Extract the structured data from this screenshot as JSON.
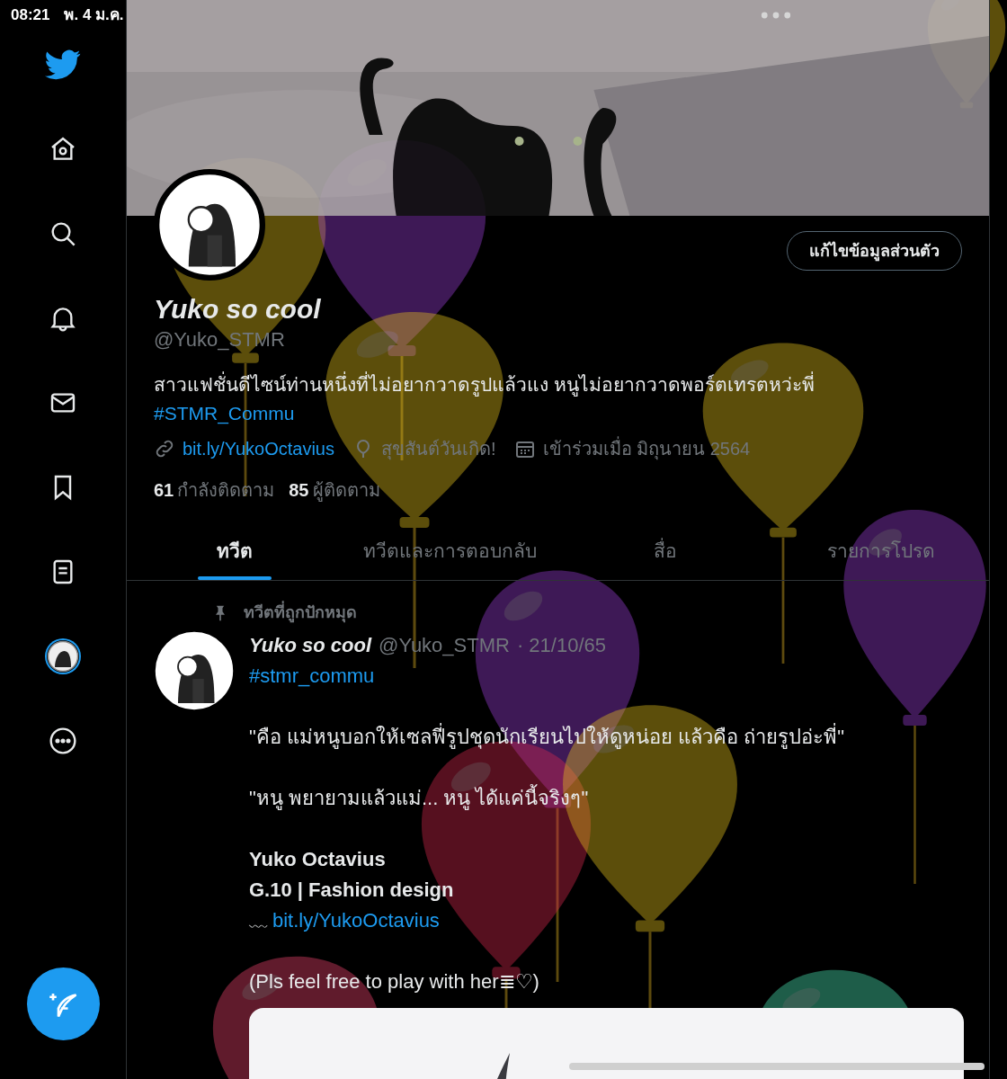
{
  "status_bar": {
    "time": "08:21",
    "date": "พ. 4 ม.ค."
  },
  "sidebar": {
    "items": [
      {
        "kind": "logo",
        "selected": false
      },
      {
        "kind": "home",
        "selected": false
      },
      {
        "kind": "search",
        "selected": false
      },
      {
        "kind": "notifications",
        "selected": false
      },
      {
        "kind": "messages",
        "selected": false
      },
      {
        "kind": "bookmarks",
        "selected": false
      },
      {
        "kind": "lists",
        "selected": false
      },
      {
        "kind": "profile",
        "selected": true
      },
      {
        "kind": "more",
        "selected": false
      }
    ]
  },
  "profile": {
    "edit_button": "แก้ไขข้อมูลส่วนตัว",
    "name": "Yuko so cool",
    "handle": "@Yuko_STMR",
    "bio": "สาวแฟชั่นดีไซน์ท่านหนึ่งที่ไม่อยากวาดรูปแล้วแง หนูไม่อยากวาดพอร์ตเทรตหว่ะพี่",
    "hashtag": "#STMR_Commu",
    "link": "bit.ly/YukoOctavius",
    "birthday": "สุขสันต์วันเกิด!",
    "joined": "เข้าร่วมเมื่อ มิถุนายน 2564",
    "following_count": "61",
    "following_label": "กำลังติดตาม",
    "followers_count": "85",
    "followers_label": "ผู้ติดตาม"
  },
  "tabs": [
    {
      "label": "ทวีต",
      "selected": true
    },
    {
      "label": "ทวีตและการตอบกลับ",
      "selected": false
    },
    {
      "label": "สื่อ",
      "selected": false
    },
    {
      "label": "รายการโปรด",
      "selected": false
    }
  ],
  "pinned_label": "ทวีตที่ถูกปักหมุด",
  "tweet": {
    "name": "Yuko so cool",
    "handle": "@Yuko_STMR",
    "date": "· 21/10/65",
    "hashtag": "#stmr_commu",
    "lines": [
      {
        "kind": "gap"
      },
      {
        "kind": "text",
        "text": "\"คือ แม่หนูบอกให้เซลฟี่รูปชุดนักเรียนไปให้ดูหน่อย แล้วคือ ถ่ายรูปอ่ะพี่\""
      },
      {
        "kind": "gap"
      },
      {
        "kind": "text",
        "text": "\"หนู พยายามแล้วแม่... หนู ได้แค่นี้จริงๆ\""
      },
      {
        "kind": "gap"
      },
      {
        "kind": "bold",
        "text": "Yuko Octavius"
      },
      {
        "kind": "bold",
        "text": "G.10 | Fashion design"
      },
      {
        "kind": "link",
        "prefix": "﹏",
        "text": "bit.ly/YukoOctavius"
      },
      {
        "kind": "gap"
      },
      {
        "kind": "text",
        "text": "(Pls feel free to play with her≣♡)"
      }
    ]
  }
}
